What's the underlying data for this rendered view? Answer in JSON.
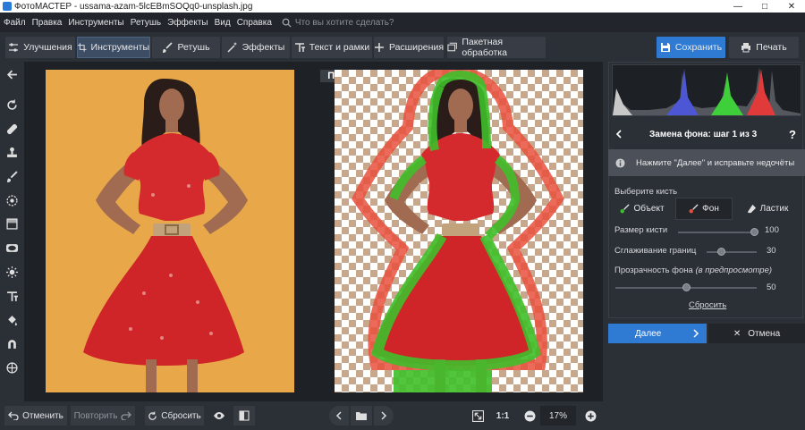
{
  "window": {
    "title": "ФотоМАСТЕР - ussama-azam-5lcEBmSOQq0-unsplash.jpg"
  },
  "menu": {
    "items": [
      "Файл",
      "Правка",
      "Инструменты",
      "Ретушь",
      "Эффекты",
      "Вид",
      "Справка"
    ],
    "search_placeholder": "Что вы хотите сделать?"
  },
  "toolbar": {
    "tabs": [
      "Улучшения",
      "Инструменты",
      "Ретушь",
      "Эффекты",
      "Текст и рамки",
      "Расширения"
    ],
    "active_tab": "Инструменты",
    "batch": "Пакетная обработка",
    "save": "Сохранить",
    "print": "Печать"
  },
  "canvas": {
    "before_label": "До",
    "after_label": "После"
  },
  "bottom": {
    "undo": "Отменить",
    "redo": "Повторить",
    "reset": "Сбросить",
    "ratio": "1:1",
    "zoom": "17%"
  },
  "panel": {
    "title": "Замена фона: шаг 1 из 3",
    "help": "?",
    "hint": "Нажмите \"Далее\" и исправьте недочёты",
    "brush_label": "Выберите кисть",
    "brushes": [
      "Объект",
      "Фон",
      "Ластик"
    ],
    "active_brush": "Фон",
    "brush_size": {
      "label": "Размер кисти",
      "value": "100",
      "fraction": 0.97
    },
    "smoothing": {
      "label": "Сглаживание границ",
      "value": "30",
      "fraction": 0.3
    },
    "opacity": {
      "label": "Прозрачность фона",
      "label_note": "(в предпросмотре)",
      "value": "50",
      "fraction": 0.5
    },
    "reset": "Сбросить",
    "next": "Далее",
    "cancel": "Отмена"
  },
  "colors": {
    "accent": "#2f7bd3",
    "object_mask": "#3fbf2a",
    "background_mask": "#e8503c",
    "before_bg": "#e8a84a"
  }
}
